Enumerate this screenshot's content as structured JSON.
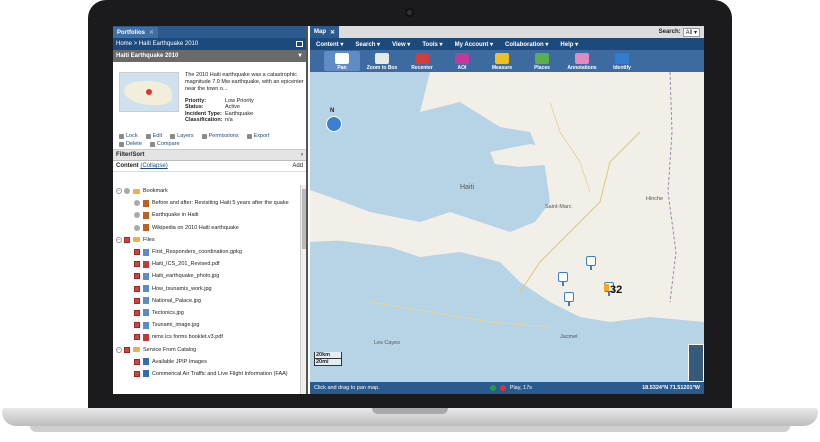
{
  "left_panel": {
    "tab_label": "Portfolios",
    "breadcrumb": "Home > Haiti Earthquake 2010",
    "portfolio_title": "Haiti Earthquake 2010",
    "description": "The 2010 Haiti earthquake was a catastrophic magnitude 7.0 Mw earthquake, with an epicenter near the town o...",
    "properties": [
      {
        "key": "Priority:",
        "value": "Low Priority"
      },
      {
        "key": "Status:",
        "value": "Active"
      },
      {
        "key": "Incident Type:",
        "value": "Earthquake"
      },
      {
        "key": "Classification:",
        "value": "n/a"
      }
    ],
    "actions_row1": [
      "Lock",
      "Edit",
      "Layers",
      "Permissions",
      "Export"
    ],
    "actions_row2": [
      "Delete",
      "Compare"
    ],
    "filter_label": "Filter/Sort",
    "content_label": "Content",
    "collapse_label": "(Collapse)",
    "add_label": "Add",
    "tree": [
      {
        "label": "Bookmark",
        "type": "folder",
        "level": 0
      },
      {
        "label": "Before and after: Revisiting Haiti 5 years after the quake",
        "type": "bookmark",
        "level": 1
      },
      {
        "label": "Earthquake in Haiti",
        "type": "bookmark",
        "level": 1
      },
      {
        "label": "Wikipedia on 2010 Haiti earthquake",
        "type": "bookmark",
        "level": 1
      },
      {
        "label": "Files",
        "type": "folder",
        "level": 0
      },
      {
        "label": "First_Responders_coordination.gpkg",
        "type": "file",
        "level": 1
      },
      {
        "label": "Haiti_ICS_201_Revised.pdf",
        "type": "pdf",
        "level": 1
      },
      {
        "label": "Haiti_earthquake_photo.jpg",
        "type": "img",
        "level": 1
      },
      {
        "label": "How_tsunamis_work.jpg",
        "type": "img",
        "level": 1
      },
      {
        "label": "National_Palace.jpg",
        "type": "img",
        "level": 1
      },
      {
        "label": "Tectonics.jpg",
        "type": "img",
        "level": 1
      },
      {
        "label": "Tsunami_image.jpg",
        "type": "img",
        "level": 1
      },
      {
        "label": "nims ics forms booklet.v3.pdf",
        "type": "pdf",
        "level": 1
      },
      {
        "label": "Service From Catalog",
        "type": "folder",
        "level": 0
      },
      {
        "label": "Available JPIP Images",
        "type": "svc",
        "level": 1
      },
      {
        "label": "Commerical Air Traffic and Live Flight Information (FAA)",
        "type": "svc",
        "level": 1
      }
    ]
  },
  "map_panel": {
    "tab_label": "Map",
    "search_label": "Search:",
    "search_option": "All",
    "menu": [
      "Content",
      "Search",
      "View",
      "Tools",
      "My Account",
      "Collaboration",
      "Help"
    ],
    "tools": [
      {
        "label": "Pan",
        "color": "#ffffff"
      },
      {
        "label": "Zoom to Box",
        "color": "#e8e8e8"
      },
      {
        "label": "Recenter",
        "color": "#d43c3c"
      },
      {
        "label": "AOI",
        "color": "#c4389e"
      },
      {
        "label": "Measure",
        "color": "#f0c020"
      },
      {
        "label": "Places",
        "color": "#5ab04a"
      },
      {
        "label": "Annotations",
        "color": "#e08ac0"
      },
      {
        "label": "Identify",
        "color": "#2f7fd0"
      }
    ],
    "map_labels": [
      {
        "text": "Haiti"
      },
      {
        "text": "Saint-Marc"
      },
      {
        "text": "Hinche"
      },
      {
        "text": "Les Cayes"
      },
      {
        "text": "Jacmel"
      }
    ],
    "cluster_count": "32",
    "scale_km": "20km",
    "scale_mi": "20mi",
    "status_text": "Click and drag to pan map.",
    "play_label": "Play, 17s",
    "coordinates": "18.5324°N 71.51201°W"
  }
}
